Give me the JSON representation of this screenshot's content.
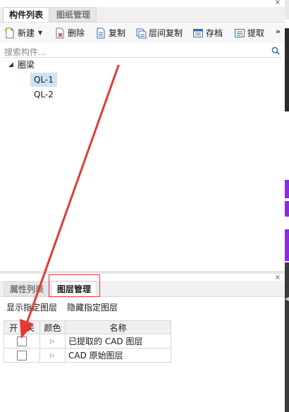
{
  "top_panel": {
    "close_label": "×",
    "tabs": [
      {
        "label": "构件列表",
        "active": true
      },
      {
        "label": "图纸管理",
        "active": false
      }
    ],
    "toolbar": {
      "new_label": "新建",
      "delete_label": "删除",
      "copy_label": "复制",
      "floor_copy_label": "层间复制",
      "archive_label": "存档",
      "extract_label": "提取",
      "overflow_label": "»"
    },
    "search": {
      "placeholder": "搜索构件..."
    },
    "tree": {
      "root_label": "圈梁",
      "items": [
        {
          "label": "QL-1",
          "selected": true
        },
        {
          "label": "QL-2",
          "selected": false
        }
      ]
    }
  },
  "bottom_panel": {
    "close_label": "×",
    "tabs": [
      {
        "label": "属性列表",
        "active": false
      },
      {
        "label": "图层管理",
        "active": true
      }
    ],
    "toolbar": {
      "show_label": "显示指定图层",
      "hide_label": "隐藏指定图层"
    },
    "columns": {
      "toggle": "开 / 关",
      "color": "颜色",
      "name": "名称"
    },
    "rows": [
      {
        "name": "已提取的 CAD 图层",
        "checked": false
      },
      {
        "name": "CAD 原始图层",
        "checked": false
      }
    ]
  },
  "colors": {
    "accent_red": "#e53935",
    "selection_blue": "#cfe3f6",
    "right_edge_purple": "#8a2be2"
  }
}
